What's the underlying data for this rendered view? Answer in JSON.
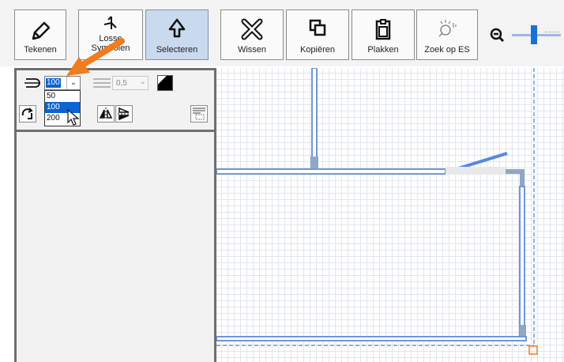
{
  "toolbar": {
    "buttons": [
      {
        "label": "Tekenen",
        "icon": "pencil-icon"
      },
      {
        "label_line1": "Losse",
        "label_line2": "Symbolen",
        "icon": "symbol-icon"
      },
      {
        "label": "Selecteren",
        "icon": "cursor-icon",
        "active": true
      },
      {
        "label": "Wissen",
        "icon": "delete-icon"
      },
      {
        "label": "Kopiëren",
        "icon": "copy-icon"
      },
      {
        "label": "Plakken",
        "icon": "paste-icon"
      },
      {
        "label": "Zoek op ES",
        "icon": "search-es-icon"
      }
    ],
    "zoom_icon": "zoom-out-icon"
  },
  "panel": {
    "scale_dropdown": {
      "selected": "100",
      "options": [
        "50",
        "100",
        "200"
      ],
      "highlighted": "100"
    },
    "line_width": {
      "value": "0,5"
    }
  },
  "colors": {
    "accent": "#0a64d3",
    "wall": "#6f96df",
    "arrow": "#f07c1e",
    "panel_border": "#6f6f6f"
  }
}
